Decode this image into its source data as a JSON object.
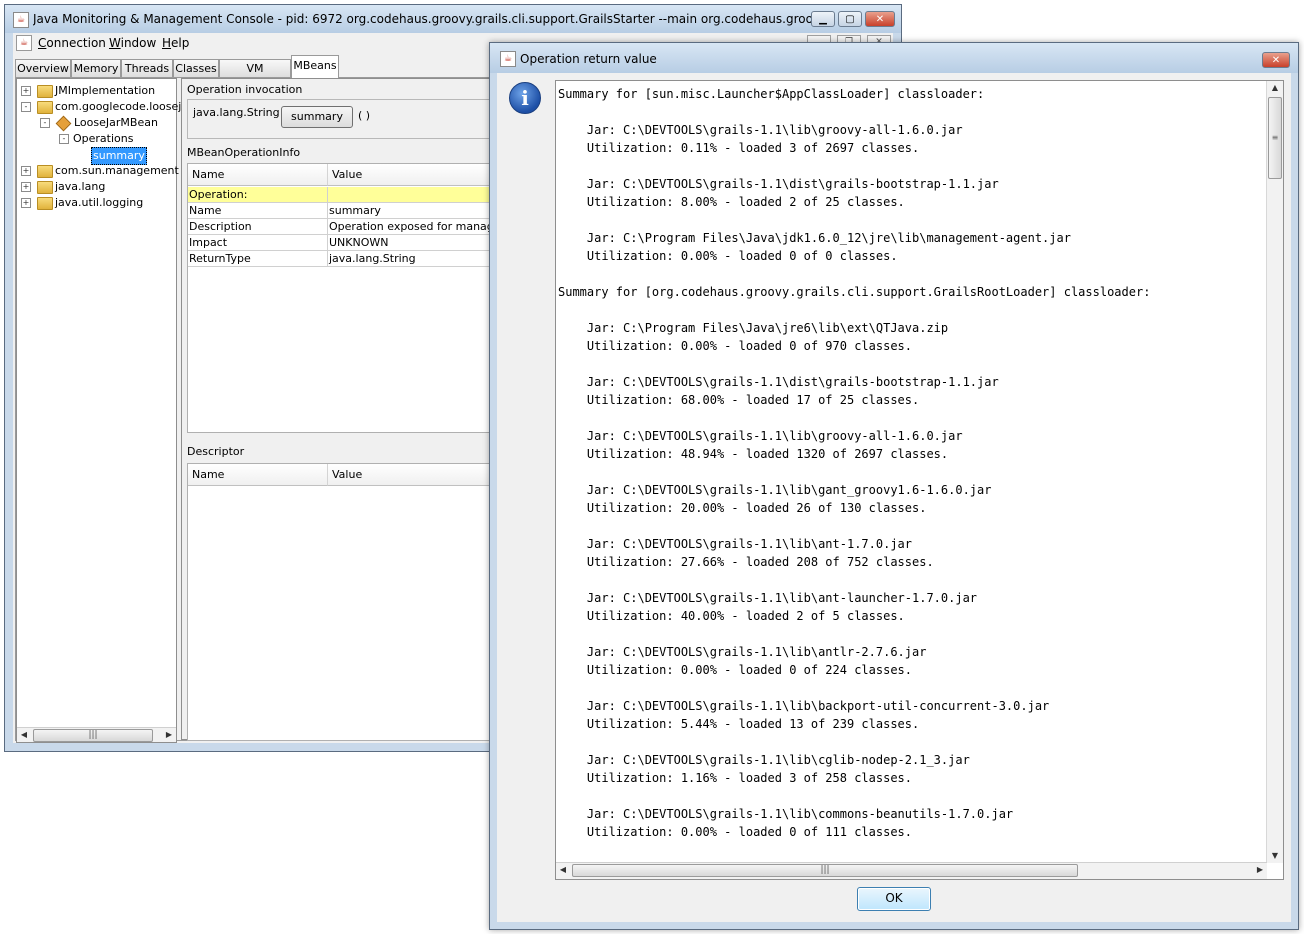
{
  "main_window": {
    "title": "Java Monitoring & Management Console - pid: 6972 org.codehaus.groovy.grails.cli.support.GrailsStarter --main org.codehaus.groovy.grails.cli.G...",
    "menu": [
      {
        "label": "Connection",
        "mnemonic": "C"
      },
      {
        "label": "Window",
        "mnemonic": "W"
      },
      {
        "label": "Help",
        "mnemonic": "H"
      }
    ],
    "tabs": [
      "Overview",
      "Memory",
      "Threads",
      "Classes",
      "VM Summary",
      "MBeans"
    ],
    "active_tab": "MBeans",
    "tree": [
      {
        "label": "JMImplementation",
        "expander": "+"
      },
      {
        "label": "com.googlecode.loosejar",
        "expander": "-"
      },
      {
        "label": "LooseJarMBean",
        "expander": "-"
      },
      {
        "label": "Operations",
        "expander": "-"
      },
      {
        "label": "summary",
        "selected": true
      },
      {
        "label": "com.sun.management",
        "expander": "+"
      },
      {
        "label": "java.lang",
        "expander": "+"
      },
      {
        "label": "java.util.logging",
        "expander": "+"
      }
    ],
    "operation_invocation": {
      "title": "Operation invocation",
      "return_type": "java.lang.String",
      "button": "summary",
      "params": "( )"
    },
    "mbean_operation_info": {
      "title": "MBeanOperationInfo",
      "columns": [
        "Name",
        "Value"
      ],
      "rows": [
        {
          "name": "Operation:",
          "value": "",
          "highlight": true
        },
        {
          "name": "Name",
          "value": "summary"
        },
        {
          "name": "Description",
          "value": "Operation exposed for management"
        },
        {
          "name": "Impact",
          "value": "UNKNOWN"
        },
        {
          "name": "ReturnType",
          "value": "java.lang.String"
        }
      ]
    },
    "descriptor": {
      "title": "Descriptor",
      "columns": [
        "Name",
        "Value"
      ]
    }
  },
  "dialog": {
    "title": "Operation return value",
    "icon": "info-icon",
    "lines": [
      "Summary for [sun.misc.Launcher$AppClassLoader] classloader:",
      "",
      "    Jar: C:\\DEVTOOLS\\grails-1.1\\lib\\groovy-all-1.6.0.jar",
      "    Utilization: 0.11% - loaded 3 of 2697 classes.",
      "",
      "    Jar: C:\\DEVTOOLS\\grails-1.1\\dist\\grails-bootstrap-1.1.jar",
      "    Utilization: 8.00% - loaded 2 of 25 classes.",
      "",
      "    Jar: C:\\Program Files\\Java\\jdk1.6.0_12\\jre\\lib\\management-agent.jar",
      "    Utilization: 0.00% - loaded 0 of 0 classes.",
      "",
      "Summary for [org.codehaus.groovy.grails.cli.support.GrailsRootLoader] classloader:",
      "",
      "    Jar: C:\\Program Files\\Java\\jre6\\lib\\ext\\QTJava.zip",
      "    Utilization: 0.00% - loaded 0 of 970 classes.",
      "",
      "    Jar: C:\\DEVTOOLS\\grails-1.1\\dist\\grails-bootstrap-1.1.jar",
      "    Utilization: 68.00% - loaded 17 of 25 classes.",
      "",
      "    Jar: C:\\DEVTOOLS\\grails-1.1\\lib\\groovy-all-1.6.0.jar",
      "    Utilization: 48.94% - loaded 1320 of 2697 classes.",
      "",
      "    Jar: C:\\DEVTOOLS\\grails-1.1\\lib\\gant_groovy1.6-1.6.0.jar",
      "    Utilization: 20.00% - loaded 26 of 130 classes.",
      "",
      "    Jar: C:\\DEVTOOLS\\grails-1.1\\lib\\ant-1.7.0.jar",
      "    Utilization: 27.66% - loaded 208 of 752 classes.",
      "",
      "    Jar: C:\\DEVTOOLS\\grails-1.1\\lib\\ant-launcher-1.7.0.jar",
      "    Utilization: 40.00% - loaded 2 of 5 classes.",
      "",
      "    Jar: C:\\DEVTOOLS\\grails-1.1\\lib\\antlr-2.7.6.jar",
      "    Utilization: 0.00% - loaded 0 of 224 classes.",
      "",
      "    Jar: C:\\DEVTOOLS\\grails-1.1\\lib\\backport-util-concurrent-3.0.jar",
      "    Utilization: 5.44% - loaded 13 of 239 classes.",
      "",
      "    Jar: C:\\DEVTOOLS\\grails-1.1\\lib\\cglib-nodep-2.1_3.jar",
      "    Utilization: 1.16% - loaded 3 of 258 classes.",
      "",
      "    Jar: C:\\DEVTOOLS\\grails-1.1\\lib\\commons-beanutils-1.7.0.jar",
      "    Utilization: 0.00% - loaded 0 of 111 classes."
    ],
    "ok_label": "OK"
  }
}
